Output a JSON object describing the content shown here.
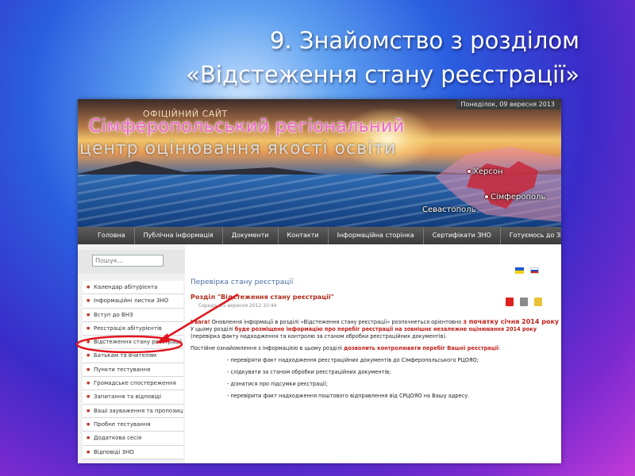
{
  "slide": {
    "title_line1": "9. Знайомство з розділом",
    "title_line2": "«Відстеження стану реєстрації»"
  },
  "site": {
    "official_label": "ОФІЦІЙНИЙ САЙТ",
    "center_name": "Сімферопольський регіональний",
    "center_sub": "центр оцінювання якості освіти",
    "date": "Понеділок, 09 вересня 2013",
    "cities": [
      "Херсон",
      "Сімферополь",
      "Севастополь"
    ]
  },
  "nav": {
    "items": [
      "Головна",
      "Публічна інформація",
      "Документи",
      "Контакти",
      "Інформаційна сторінка",
      "Сертифікати ЗНО",
      "Готуємось до ЗНО"
    ]
  },
  "search": {
    "placeholder": "Пошук..."
  },
  "sidebar": {
    "items": [
      "Календар абітурієнта",
      "Інформаційні листки ЗНО",
      "Вступ до ВНЗ",
      "Реєстрація абітурієнтів",
      "Відстеження стану реєстрації",
      "Батькам та вчителям",
      "Пункти тестування",
      "Громадське спостереження",
      "Запитання та відповіді",
      "Ваші зауваження та пропозиції",
      "Пробне тестування",
      "Додаткова сесія",
      "Відповіді ЗНО"
    ],
    "highlighted_index": 4
  },
  "content": {
    "title": "Перевірка стану реєстрації",
    "heading": "Розділ \"Відстеження стану реєстрації\"",
    "date": "Середа, 25 вересня 2012 10:44",
    "notice_label": "Увага!",
    "notice_text": " Оновлення інформації в розділі «Відстеження стану реєстрації» розпочнеться орієнтовно ",
    "notice_date": "з початку січня 2014 року",
    "line2_a": "У цьому розділі ",
    "line2_b": "буде розміщено інформацію про перебіг реєстрації на зовнішнє незалежне оцінювання 2014 року",
    "line3": "(перевірка факту надходження та контролю за станом обробки реєстраційних документів).",
    "line4_a": "Постійне ознайомлення з інформацією в цьому розділі ",
    "line4_b": "дозволить контролювати перебіг Вашої реєстрації",
    "line4_c": ":",
    "bullets": [
      "- перевіряти факт надходження реєстраційних документів до Сімферопольського РЦОЯО;",
      "- слідкувати за станом обробки реєстраційних документів;",
      "- дізнатися про підсумки реєстрації;",
      "- перевірити факт надходження поштового відправлення від СРЦОЯО на Вашу адресу."
    ]
  },
  "colors": {
    "highlight_ellipse": "#e0141e",
    "arrow": "#e0141e"
  }
}
